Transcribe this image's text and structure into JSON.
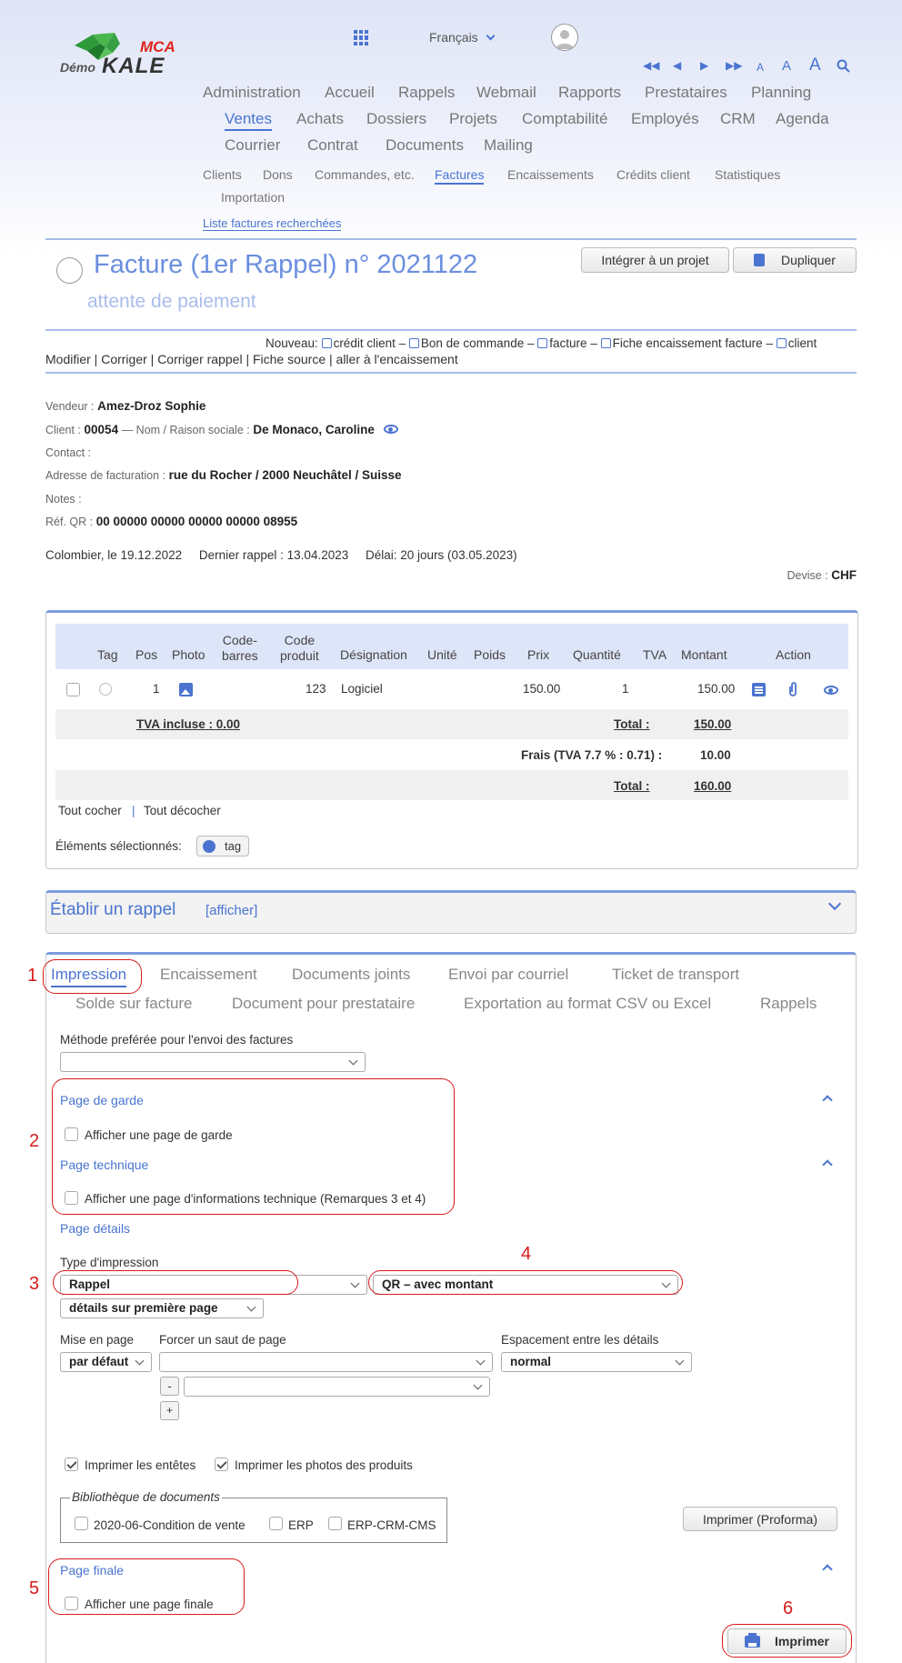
{
  "logo": {
    "brand": "MCA",
    "demo": "Démo",
    "name": "KALE"
  },
  "header": {
    "language": "Français",
    "font_small": "A",
    "font_medium": "A",
    "font_large": "A"
  },
  "nav": {
    "row1": [
      "Administration",
      "Accueil",
      "Rappels",
      "Webmail",
      "Rapports",
      "Prestataires",
      "Planning"
    ],
    "row2": [
      "Ventes",
      "Achats",
      "Dossiers",
      "Projets",
      "Comptabilité",
      "Employés",
      "CRM",
      "Agenda"
    ],
    "row3": [
      "Courrier",
      "Contrat",
      "Documents",
      "Mailing"
    ],
    "sub": [
      "Clients",
      "Dons",
      "Commandes, etc.",
      "Factures",
      "Encaissements",
      "Crédits client",
      "Statistiques"
    ],
    "sub2": "Importation",
    "breadcrumb": "Liste factures recherchées"
  },
  "doc": {
    "title": "Facture (1er Rappel) n° 2021122",
    "status": "attente de paiement",
    "btn_integrate": "Intégrer à un projet",
    "btn_duplicate": "Dupliquer",
    "new_label": "Nouveau:",
    "new_links": [
      "crédit client",
      "Bon de commande",
      "facture",
      "Fiche encaissement facture",
      "client"
    ],
    "sep": "–",
    "actions": "Modifier | Corriger | Corriger rappel | Fiche source | aller à l'encaissement"
  },
  "info": {
    "seller_label": "Vendeur :",
    "seller": "Amez-Droz Sophie",
    "client_label": "Client :",
    "client_no": "00054",
    "name_label": "— Nom / Raison sociale :",
    "client_name": "De Monaco, Caroline",
    "contact_label": "Contact :",
    "address_label": "Adresse de facturation :",
    "address": "rue du Rocher / 2000 Neuchâtel / Suisse",
    "notes_label": "Notes :",
    "qr_label": "Réf. QR :",
    "qr": "00 00000 00000 00000 00000 08955",
    "place_date": "Colombier, le 19.12.2022",
    "last_reminder": "Dernier rappel : 13.04.2023",
    "delay": "Délai: 20 jours (03.05.2023)",
    "currency_label": "Devise :",
    "currency": "CHF"
  },
  "table": {
    "headers": {
      "tag": "Tag",
      "pos": "Pos",
      "photo": "Photo",
      "barcode1": "Code-",
      "barcode2": "barres",
      "code1": "Code",
      "code2": "produit",
      "designation": "Désignation",
      "unit": "Unité",
      "weight": "Poids",
      "price": "Prix",
      "qty": "Quantité",
      "vat": "TVA",
      "amount": "Montant",
      "action": "Action"
    },
    "row": {
      "pos": "1",
      "code": "123",
      "designation": "Logiciel",
      "price": "150.00",
      "qty": "1",
      "amount": "150.00"
    },
    "vat_included": "TVA incluse :  0.00",
    "total_label": "Total :",
    "subtotal": "150.00",
    "fees_label": "Frais (TVA 7.7 % : 0.71) :",
    "fees": "10.00",
    "total2_label": "Total :",
    "total": "160.00",
    "check_all": "Tout cocher",
    "pipe": "|",
    "uncheck_all": "Tout décocher",
    "selected_label": "Éléments sélectionnés:",
    "tag_btn": "tag"
  },
  "reminder": {
    "title": "Établir un rappel",
    "toggle": "[afficher]"
  },
  "tabs": {
    "row1": [
      "Impression",
      "Encaissement",
      "Documents joints",
      "Envoi par courriel",
      "Ticket de transport"
    ],
    "row2": [
      "Solde sur facture",
      "Document pour prestataire",
      "Exportation au format CSV ou Excel",
      "Rappels"
    ]
  },
  "print": {
    "method_label": "Méthode preférée pour l'envoi des factures",
    "method_value": "",
    "cover_title": "Page de garde",
    "cover_check": "Afficher une page de garde",
    "tech_title": "Page technique",
    "tech_check": "Afficher une page d'informations technique (Remarques 3 et 4)",
    "details_title": "Page détails",
    "type_label": "Type d'impression",
    "type_value": "Rappel",
    "qr_value": "QR – avec montant",
    "details_value": "détails sur première page",
    "layout_label": "Mise en page",
    "layout_value": "par défaut",
    "break_label": "Forcer un saut de page",
    "break_value": "",
    "break_value2": "",
    "minus": "-",
    "plus": "+",
    "spacing_label": "Espacement entre les détails",
    "spacing_value": "normal",
    "print_headers": "Imprimer les entêtes",
    "print_photos": "Imprimer les photos des produits",
    "library_legend": "Bibliothèque de documents",
    "library": [
      "2020-06-Condition de vente",
      "ERP",
      "ERP-CRM-CMS"
    ],
    "proforma_btn": "Imprimer (Proforma)",
    "final_title": "Page finale",
    "final_check": "Afficher une page finale",
    "print_btn": "Imprimer"
  },
  "annotations": [
    "1",
    "2",
    "3",
    "4",
    "5",
    "6"
  ],
  "colors": {
    "accent": "#4a74d0",
    "annotation": "#d81b1b",
    "header_bg": "#dfe5f7"
  }
}
